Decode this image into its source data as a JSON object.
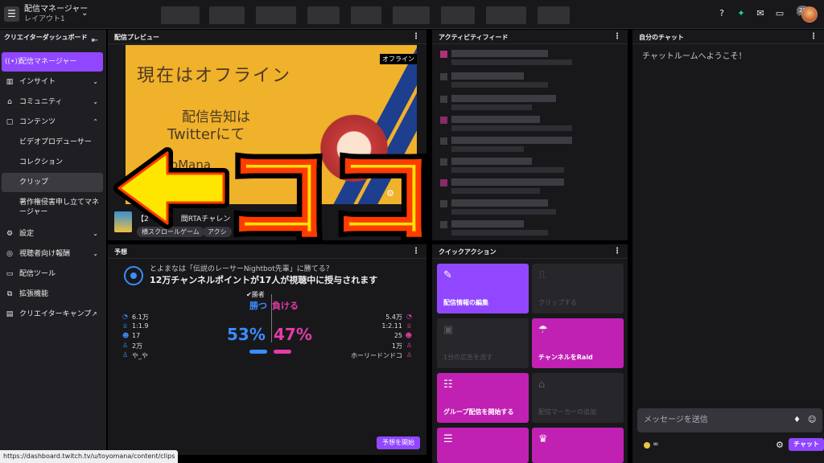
{
  "topbar": {
    "title": "配信マネージャー",
    "subtitle": "レイアウト1",
    "notification_count": "28"
  },
  "sidebar": {
    "header": "クリエイターダッシュボード",
    "items": [
      {
        "label": "配信マネージャー",
        "icon": "broadcast-icon"
      },
      {
        "label": "インサイト",
        "icon": "chart-icon"
      },
      {
        "label": "コミュニティ",
        "icon": "community-icon"
      },
      {
        "label": "コンテンツ",
        "icon": "content-icon"
      },
      {
        "label": "ビデオプロデューサー"
      },
      {
        "label": "コレクション"
      },
      {
        "label": "クリップ"
      },
      {
        "label": "著作権侵害申し立てマネージャー"
      },
      {
        "label": "設定",
        "icon": "gear-icon"
      },
      {
        "label": "視聴者向け報酬",
        "icon": "reward-icon"
      },
      {
        "label": "配信ツール",
        "icon": "tools-icon"
      },
      {
        "label": "拡張機能",
        "icon": "extensions-icon"
      },
      {
        "label": "クリエイターキャンプ",
        "icon": "camp-icon"
      }
    ]
  },
  "preview": {
    "title": "配信プレビュー",
    "offline_banner": "現在はオフライン",
    "announce_line1": "配信告知は",
    "announce_line2": "Twitterにて",
    "offline_tag": "オフライン",
    "watermark": "oyoMana",
    "stream_title": "【2",
    "stream_title_tail": "間RTAチャレン",
    "tags": [
      "横スクロールゲーム",
      "アクシ"
    ]
  },
  "prediction": {
    "title": "予想",
    "question": "とよまなは「伝説のレーサーNightbot先輩」に勝てる？",
    "reward": "12万チャンネルポイントが17人が視聴中に授与されます",
    "winner_label": "勝者",
    "outcome_blue": "勝つ",
    "outcome_pink": "負ける",
    "percent_blue": "53%",
    "percent_pink": "47%",
    "stats_blue": [
      "6.1万",
      "1:1.9",
      "17",
      "2万",
      "や_や"
    ],
    "stats_pink": [
      "5.4万",
      "1:2.11",
      "25",
      "1万",
      "ホーリードンドコ"
    ],
    "start_button": "予想を開始"
  },
  "activity": {
    "title": "アクティビティフィード"
  },
  "quick_actions": {
    "title": "クイックアクション",
    "items": [
      {
        "label": "配信情報の編集",
        "icon": "pencil-icon"
      },
      {
        "label": "クリップする",
        "icon": "clip-icon"
      },
      {
        "label": "1分の広告を流す",
        "icon": "ad-icon"
      },
      {
        "label": "チャンネルをRaid",
        "icon": "raid-icon"
      },
      {
        "label": "グループ配信を開始する",
        "icon": "group-icon"
      },
      {
        "label": "配信マーカーの追加",
        "icon": "marker-icon"
      },
      {
        "label": "",
        "icon": "layout-icon"
      },
      {
        "label": "",
        "icon": "crown-icon"
      }
    ]
  },
  "chat": {
    "title": "自分のチャット",
    "welcome": "チャットルームへようこそ！",
    "input_placeholder": "メッセージを送信",
    "points": "∞",
    "send_button": "チャット"
  },
  "status_url": "https://dashboard.twitch.tv/u/toyomana/content/clips",
  "annotation": {
    "text": "ココ",
    "color": "#ffe600"
  }
}
